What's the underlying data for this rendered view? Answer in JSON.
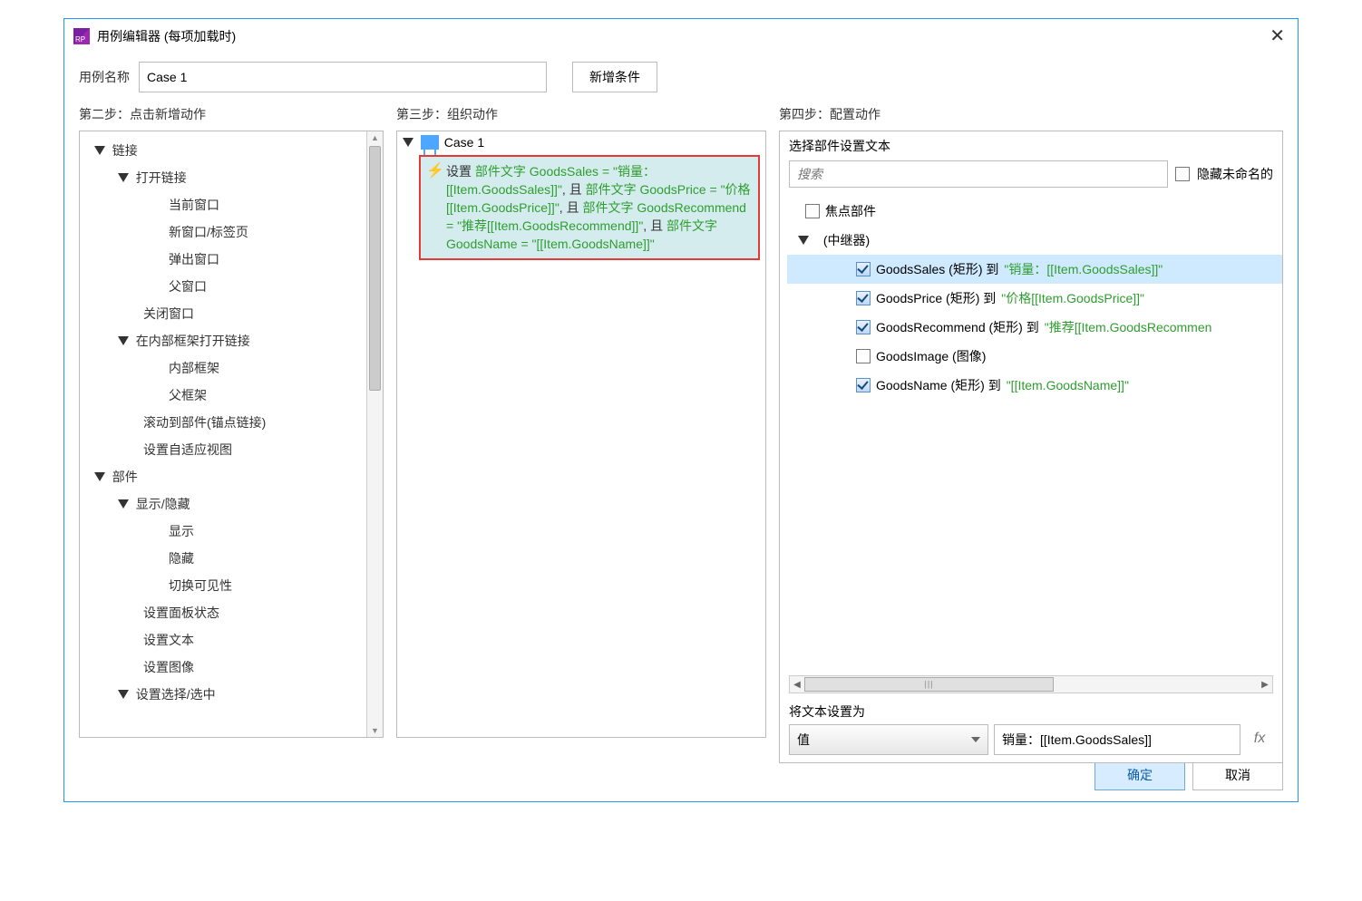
{
  "window": {
    "title": "用例编辑器 (每项加载时)"
  },
  "top": {
    "case_name_label": "用例名称",
    "case_name_value": "Case 1",
    "add_condition": "新增条件"
  },
  "step2": {
    "header": "第二步：点击新增动作",
    "tree": {
      "links": "链接",
      "open_link": "打开链接",
      "current_window": "当前窗口",
      "new_window": "新窗口/标签页",
      "popup_window": "弹出窗口",
      "parent_window": "父窗口",
      "close_window": "关闭窗口",
      "open_in_frame": "在内部框架打开链接",
      "inner_frame": "内部框架",
      "parent_frame": "父框架",
      "scroll_to": "滚动到部件(锚点链接)",
      "set_adaptive": "设置自适应视图",
      "widgets": "部件",
      "show_hide": "显示/隐藏",
      "show": "显示",
      "hide": "隐藏",
      "toggle_vis": "切换可见性",
      "set_panel": "设置面板状态",
      "set_text": "设置文本",
      "set_image": "设置图像",
      "set_select": "设置选择/选中"
    }
  },
  "step3": {
    "header": "第三步：组织动作",
    "case_label": "Case 1",
    "action": {
      "prefix": "设置 ",
      "parts": [
        {
          "g": "部件文字 GoodsSales = \"销量：[[Item.GoodsSales]]\""
        },
        {
          "t": ", 且"
        },
        {
          "g": " 部件文字 GoodsPrice = \"价格[[Item.GoodsPrice]]\""
        },
        {
          "t": ", 且"
        },
        {
          "g": " 部件文字 GoodsRecommend = \"推荐[[Item.GoodsRecommend]]\""
        },
        {
          "t": ", 且"
        },
        {
          "g": " 部件文字 GoodsName = \"[[Item.GoodsName]]\""
        }
      ]
    }
  },
  "step4": {
    "header": "第四步：配置动作",
    "config_title": "选择部件设置文本",
    "search_placeholder": "搜索",
    "hide_unnamed": "隐藏未命名的",
    "focus_widget": "焦点部件",
    "repeater": "(中继器)",
    "widgets": [
      {
        "checked": true,
        "name": "GoodsSales (矩形) 到",
        "expr": "\"销量：[[Item.GoodsSales]]\"",
        "selected": true
      },
      {
        "checked": true,
        "name": "GoodsPrice (矩形) 到",
        "expr": "\"价格[[Item.GoodsPrice]]\""
      },
      {
        "checked": true,
        "name": "GoodsRecommend (矩形) 到",
        "expr": "\"推荐[[Item.GoodsRecommen"
      },
      {
        "checked": false,
        "name": "GoodsImage (图像)",
        "expr": ""
      },
      {
        "checked": true,
        "name": "GoodsName (矩形) 到",
        "expr": "\"[[Item.GoodsName]]\""
      }
    ],
    "set_text_label": "将文本设置为",
    "value_type": "值",
    "value_text": "销量：[[Item.GoodsSales]]"
  },
  "footer": {
    "ok": "确定",
    "cancel": "取消"
  }
}
